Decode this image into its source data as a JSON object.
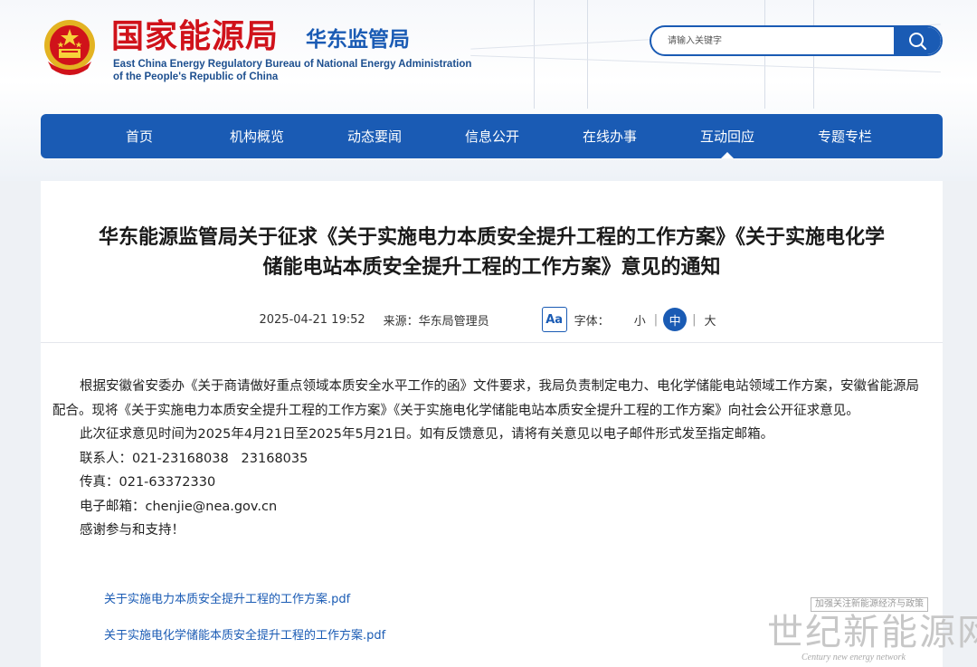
{
  "header": {
    "title": "国家能源局",
    "subtitle": "华东监管局",
    "english_line1": "East China Energy Regulatory Bureau of National Energy Administration",
    "english_line2": "of the People's Republic of China",
    "search": {
      "placeholder": "请输入关键字",
      "icon": "search-icon"
    },
    "brand_color": "#1a5bb4",
    "title_color": "#d0121a"
  },
  "nav": {
    "items": [
      {
        "label": "首页"
      },
      {
        "label": "机构概览"
      },
      {
        "label": "动态要闻"
      },
      {
        "label": "信息公开"
      },
      {
        "label": "在线办事"
      },
      {
        "label": "互动回应",
        "active": true
      },
      {
        "label": "专题专栏"
      }
    ]
  },
  "article": {
    "title_line1": "华东能源监管局关于征求《关于实施电力本质安全提升工程的工作方案》《关于实施电化学",
    "title_line2": "储能电站本质安全提升工程的工作方案》意见的通知",
    "date": "2025-04-21 19:52",
    "source_label": "来源：",
    "source": "华东局管理员",
    "font_icon_label": "Aa",
    "font_label": "字体：",
    "font_sizes": [
      "小",
      "中",
      "大"
    ],
    "font_size_selected": "中",
    "paragraph1": "根据安徽省安委办《关于商请做好重点领域本质安全水平工作的函》文件要求，我局负责制定电力、电化学储能电站领域工作方案，安徽省能源局配合。现将《关于实施电力本质安全提升工程的工作方案》《关于实施电化学储能电站本质安全提升工程的工作方案》向社会公开征求意见。",
    "paragraph2": "此次征求意见时间为2025年4月21日至2025年5月21日。如有反馈意见，请将有关意见以电子邮件形式发至指定邮箱。",
    "contact": "联系人：021-23168038   23168035",
    "fax": "传真：021-63372330",
    "email": "电子邮箱：chenjie@nea.gov.cn",
    "thanks": "感谢参与和支持！",
    "attachments": [
      "关于实施电力本质安全提升工程的工作方案.pdf",
      "关于实施电化学储能本质安全提升工程的工作方案.pdf"
    ]
  },
  "watermark": {
    "top": "加强关注新能源经济与政策",
    "main": "世纪新能源网",
    "english": "Century new energy network"
  }
}
